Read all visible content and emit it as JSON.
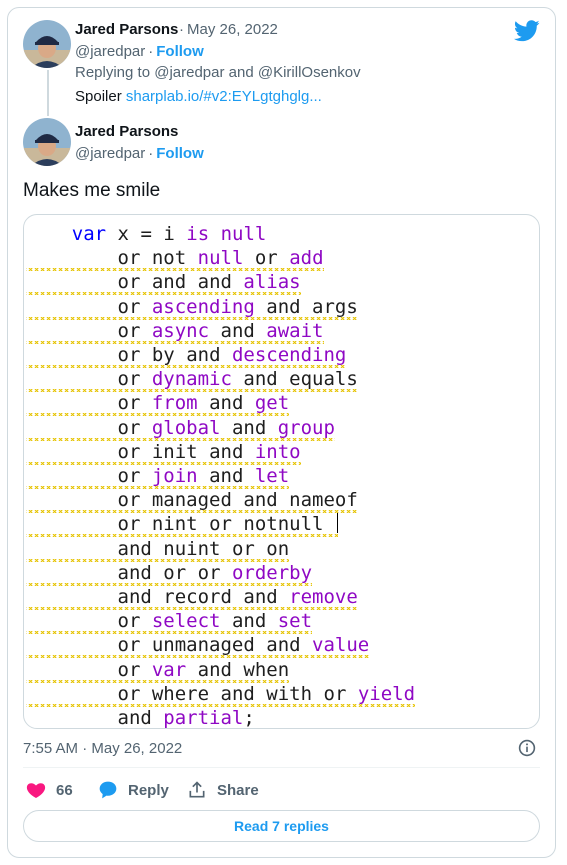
{
  "reply_tweet": {
    "author_name": "Jared Parsons",
    "date": "May 26, 2022",
    "handle": "@jaredpar",
    "follow_label": "Follow",
    "replying_prefix": "Replying to",
    "replying_user1": "@jaredpar",
    "replying_and": "and",
    "replying_user2": "@KirillOsenkov",
    "spoiler_label": "Spoiler",
    "spoiler_link": "sharplab.io/#v2:EYLgtghglg..."
  },
  "main_tweet": {
    "author_name": "Jared Parsons",
    "handle": "@jaredpar",
    "follow_label": "Follow",
    "text": "Makes me smile",
    "timestamp": "7:55 AM · May 26, 2022"
  },
  "code_lines": [
    "    var x = i is null",
    "        or not null or add",
    "        or and and alias",
    "        or ascending and args",
    "        or async and await",
    "        or by and descending",
    "        or dynamic and equals",
    "        or from and get",
    "        or global and group",
    "        or init and into",
    "        or join and let",
    "        or managed and nameof",
    "        or nint or notnull ",
    "        and nuint or on",
    "        and or or orderby",
    "        and record and remove",
    "        or select and set",
    "        or unmanaged and value",
    "        or var and when",
    "        or where and with or yield",
    "        and partial;"
  ],
  "actions": {
    "like_count": "66",
    "reply_label": "Reply",
    "share_label": "Share",
    "read_replies_label": "Read 7 replies"
  },
  "colors": {
    "accent": "#1d9bf0",
    "like": "#f91880",
    "keyword_purple": "#8f08c4",
    "keyword_blue": "#0000ff",
    "squiggle": "#e6c300"
  },
  "icons": [
    "twitter-bird-icon",
    "heart-icon",
    "reply-bubble-icon",
    "share-icon",
    "info-icon"
  ]
}
